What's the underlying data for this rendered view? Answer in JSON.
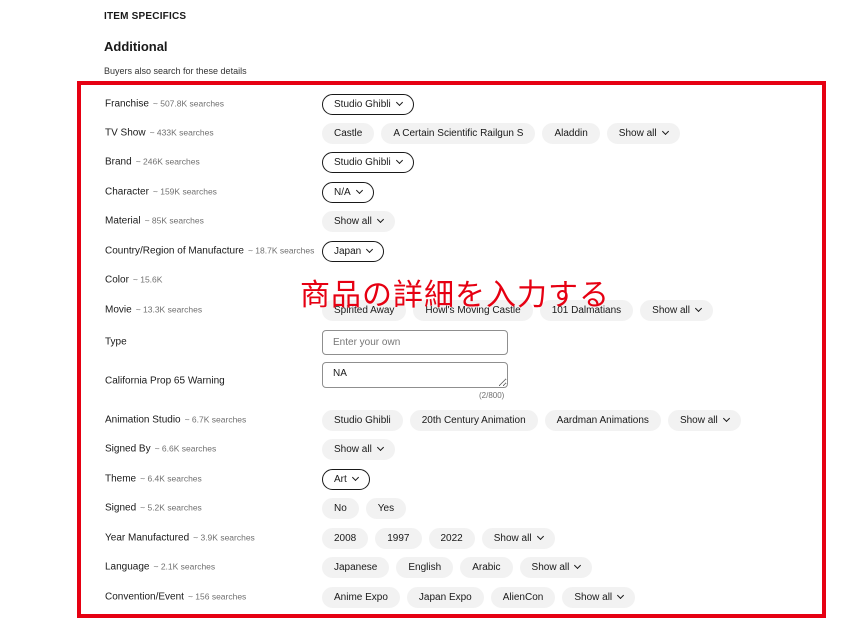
{
  "section": {
    "label": "ITEM SPECIFICS",
    "title": "Additional",
    "subtitle": "Buyers also search for these details"
  },
  "rows": [
    {
      "label": "Franchise",
      "count": "~ 507.8K searches",
      "options": [
        {
          "text": "Studio Ghibli",
          "selected": true,
          "dropdown": true
        }
      ]
    },
    {
      "label": "TV Show",
      "count": "~ 433K searches",
      "options": [
        {
          "text": "Castle"
        },
        {
          "text": "A Certain Scientific Railgun S"
        },
        {
          "text": "Aladdin"
        },
        {
          "text": "Show all",
          "dropdown": true
        }
      ]
    },
    {
      "label": "Brand",
      "count": "~ 246K searches",
      "options": [
        {
          "text": "Studio Ghibli",
          "selected": true,
          "dropdown": true
        }
      ]
    },
    {
      "label": "Character",
      "count": "~ 159K searches",
      "options": [
        {
          "text": "N/A",
          "selected": true,
          "dropdown": true
        }
      ]
    },
    {
      "label": "Material",
      "count": "~ 85K searches",
      "options": [
        {
          "text": "Show all",
          "dropdown": true
        }
      ]
    },
    {
      "label": "Country/Region of Manufacture",
      "count": "~ 18.7K searches",
      "options": [
        {
          "text": "Japan",
          "selected": true,
          "dropdown": true
        }
      ]
    },
    {
      "label": "Color",
      "count": "~ 15.6K",
      "options": []
    },
    {
      "label": "Movie",
      "count": "~ 13.3K searches",
      "options": [
        {
          "text": "Spirited Away"
        },
        {
          "text": "Howl's Moving Castle"
        },
        {
          "text": "101 Dalmatians"
        },
        {
          "text": "Show all",
          "dropdown": true
        }
      ]
    },
    {
      "label": "Type",
      "count": "",
      "input": {
        "placeholder": "Enter your own",
        "value": ""
      }
    },
    {
      "label": "California Prop 65 Warning",
      "count": "",
      "textarea": {
        "value": "NA",
        "counter": "(2/800)"
      }
    },
    {
      "label": "Animation Studio",
      "count": "~ 6.7K searches",
      "options": [
        {
          "text": "Studio Ghibli"
        },
        {
          "text": "20th Century Animation"
        },
        {
          "text": "Aardman Animations"
        },
        {
          "text": "Show all",
          "dropdown": true
        }
      ]
    },
    {
      "label": "Signed By",
      "count": "~ 6.6K searches",
      "options": [
        {
          "text": "Show all",
          "dropdown": true
        }
      ]
    },
    {
      "label": "Theme",
      "count": "~ 6.4K searches",
      "options": [
        {
          "text": "Art",
          "selected": true,
          "dropdown": true
        }
      ]
    },
    {
      "label": "Signed",
      "count": "~ 5.2K searches",
      "options": [
        {
          "text": "No"
        },
        {
          "text": "Yes"
        }
      ]
    },
    {
      "label": "Year Manufactured",
      "count": "~ 3.9K searches",
      "options": [
        {
          "text": "2008"
        },
        {
          "text": "1997"
        },
        {
          "text": "2022"
        },
        {
          "text": "Show all",
          "dropdown": true
        }
      ]
    },
    {
      "label": "Language",
      "count": "~ 2.1K searches",
      "options": [
        {
          "text": "Japanese"
        },
        {
          "text": "English"
        },
        {
          "text": "Arabic"
        },
        {
          "text": "Show all",
          "dropdown": true
        }
      ]
    },
    {
      "label": "Convention/Event",
      "count": "~ 156 searches",
      "options": [
        {
          "text": "Anime Expo"
        },
        {
          "text": "Japan Expo"
        },
        {
          "text": "AlienCon"
        },
        {
          "text": "Show all",
          "dropdown": true
        }
      ]
    }
  ],
  "overlay": {
    "text": "商品の詳細を入力する",
    "color": "#e60012"
  },
  "icons": {
    "dropdown": "chevron-down-icon"
  }
}
